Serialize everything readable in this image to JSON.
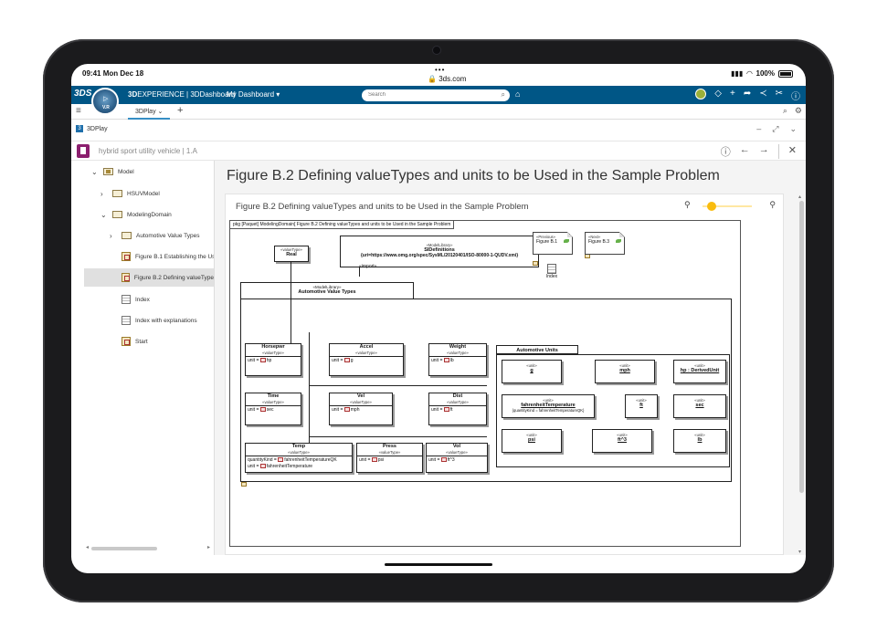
{
  "status": {
    "time": "09:41",
    "date": "Mon Dec 18",
    "url": "3ds.com",
    "battery": "100%"
  },
  "topbar": {
    "logo": "3DS",
    "compass_version": "V.R",
    "brand_prefix": "3D",
    "brand_rest": "EXPERIENCE | 3DDashboard",
    "dashboard_label": "My Dashboard",
    "search_placeholder": "Search"
  },
  "tabs": {
    "active": "3DPlay"
  },
  "widget": {
    "title": "3DPlay"
  },
  "document": {
    "title": "hybrid sport utility vehicle | 1.A"
  },
  "tree": {
    "items": [
      {
        "label": "Model"
      },
      {
        "label": "HSUVModel"
      },
      {
        "label": "ModelingDomain"
      },
      {
        "label": "Automotive Value Types"
      },
      {
        "label": "Figure B.1 Establishing the Us"
      },
      {
        "label": "Figure B.2 Defining valueType"
      },
      {
        "label": "Index"
      },
      {
        "label": "Index with explanations"
      },
      {
        "label": "Start"
      }
    ]
  },
  "content": {
    "heading": "Figure B.2 Defining valueTypes and units to be Used in the Sample Problem",
    "panel_title": "Figure B.2 Defining valueTypes and units to be Used in the Sample Problem",
    "zoom_level": 0.1
  },
  "diagram": {
    "frame_label": "pkg  [Paquet] ModelingDomain[ Figure B.2 Defining valueTypes and units to be Used in the Sample Problem",
    "real": {
      "stereotype": "«valueType»",
      "name": "Real"
    },
    "sidef": {
      "stereotype": "«ModelLibrary»",
      "name": "SIDefinitions",
      "uri": "{uri=https://www.omg.org/spec/SysML/20120401/ISO-80000-1-QUDV.xmi}"
    },
    "prev": {
      "stereotype": "«Previous»",
      "name": "Figure B.1"
    },
    "next": {
      "stereotype": "«Next»",
      "name": "Figure B.3"
    },
    "import_label": "«import»",
    "index_label": "Index",
    "avt": {
      "stereotype": "«ModelLibrary»",
      "name": "Automotive Value Types"
    },
    "vt_stereo": "«valueType»",
    "valuetypes": [
      {
        "name": "Horsepwr",
        "attr": "unit = ",
        "unit": "hp"
      },
      {
        "name": "Accel",
        "attr": "unit = ",
        "unit": "g"
      },
      {
        "name": "Weight",
        "attr": "unit = ",
        "unit": "lb"
      },
      {
        "name": "Time",
        "attr": "unit = ",
        "unit": "sec"
      },
      {
        "name": "Vel",
        "attr": "unit = ",
        "unit": "mph"
      },
      {
        "name": "Dist",
        "attr": "unit = ",
        "unit": "ft"
      },
      {
        "name": "Press",
        "attr": "unit = ",
        "unit": "psi"
      },
      {
        "name": "Vol",
        "attr": "unit = ",
        "unit": "ft^3"
      }
    ],
    "temp": {
      "name": "Temp",
      "attr1": "quantityKind = ",
      "val1": "fahrenheitTemperatureQK",
      "attr2": "unit = ",
      "val2": "fahrenheitTemperature"
    },
    "units_pkg": "Automotive Units",
    "unit_stereo": "«unit»",
    "units": [
      {
        "name": "g"
      },
      {
        "name": "mph"
      },
      {
        "name": "hp : DerivedUnit"
      },
      {
        "name": "fahrenheitTemperature",
        "extra": "{quantityKind = fahrenheitTemperatureQK}"
      },
      {
        "name": "ft"
      },
      {
        "name": "sec"
      },
      {
        "name": "psi"
      },
      {
        "name": "ft^3"
      },
      {
        "name": "lb"
      }
    ]
  }
}
